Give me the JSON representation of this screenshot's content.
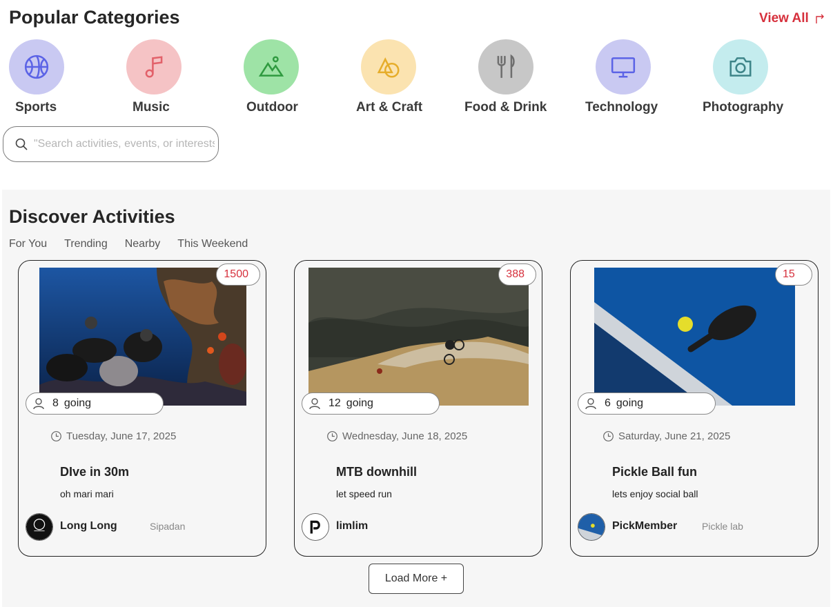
{
  "categories_section": {
    "title": "Popular Categories",
    "view_all": "View All",
    "items": [
      {
        "label": "Sports",
        "icon": "basketball-icon",
        "bg": "#c9c9f2",
        "fg": "#5b63e6"
      },
      {
        "label": "Music",
        "icon": "music-note-icon",
        "bg": "#f5c3c5",
        "fg": "#e2616a"
      },
      {
        "label": "Outdoor",
        "icon": "mountain-icon",
        "bg": "#9ee3a6",
        "fg": "#2f9a3f"
      },
      {
        "label": "Art & Craft",
        "icon": "shapes-icon",
        "bg": "#fbe3b0",
        "fg": "#e6ad2a"
      },
      {
        "label": "Food & Drink",
        "icon": "fork-knife-icon",
        "bg": "#c7c7c7",
        "fg": "#6e6e6e"
      },
      {
        "label": "Technology",
        "icon": "monitor-icon",
        "bg": "#c9c9f2",
        "fg": "#5b63e6"
      },
      {
        "label": "Photography",
        "icon": "camera-icon",
        "bg": "#c4ecee",
        "fg": "#3e8589"
      }
    ]
  },
  "search": {
    "placeholder": "\"Search activities, events, or interests\""
  },
  "discover": {
    "title": "Discover Activities",
    "tabs": [
      "For You",
      "Trending",
      "Nearby",
      "This Weekend"
    ],
    "cards": [
      {
        "count": "1500",
        "going_num": "8",
        "going_label": "going",
        "date": "Tuesday, June 17, 2025",
        "title": "DIve in 30m",
        "desc": "oh mari mari",
        "host": "Long Long",
        "location": "Sipadan",
        "image": "scuba-divers-reef"
      },
      {
        "count": "388",
        "going_num": "12",
        "going_label": "going",
        "date": "Wednesday, June 18, 2025",
        "title": "MTB downhill",
        "desc": "let speed run",
        "host": "limlim",
        "location": "",
        "image": "mountain-bike-trail"
      },
      {
        "count": "15",
        "going_num": "6",
        "going_label": "going",
        "date": "Saturday, June 21, 2025",
        "title": "Pickle Ball fun",
        "desc": "lets enjoy social ball",
        "host": "PickMember",
        "location": "Pickle lab",
        "image": "pickleball-paddle"
      }
    ],
    "load_more": "Load More +"
  },
  "colors": {
    "accent": "#d6303c",
    "discover_bg": "#f6f6f6"
  }
}
